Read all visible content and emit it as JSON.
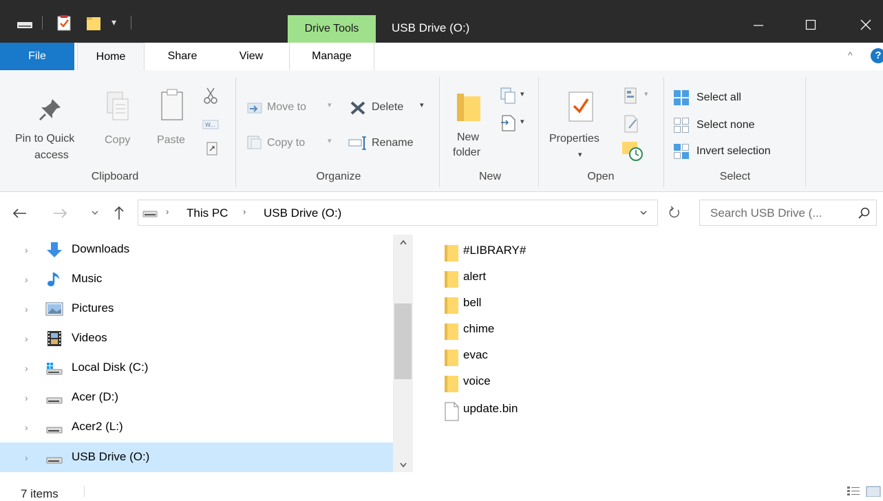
{
  "title": {
    "context_tab": "Drive Tools",
    "window_title": "USB Drive (O:)",
    "controls": {
      "minimize": "—",
      "maximize": "☐",
      "close": "✕"
    }
  },
  "tabs": {
    "file": "File",
    "home": "Home",
    "share": "Share",
    "view": "View",
    "manage": "Manage"
  },
  "ribbon": {
    "clipboard": {
      "group": "Clipboard",
      "pin_line1": "Pin to Quick",
      "pin_line2": "access",
      "copy": "Copy",
      "paste": "Paste"
    },
    "organize": {
      "group": "Organize",
      "move_to": "Move to",
      "copy_to": "Copy to",
      "delete": "Delete",
      "rename": "Rename"
    },
    "new": {
      "group": "New",
      "new_folder_line1": "New",
      "new_folder_line2": "folder"
    },
    "open": {
      "group": "Open",
      "properties": "Properties"
    },
    "select": {
      "group": "Select",
      "select_all": "Select all",
      "select_none": "Select none",
      "invert_selection": "Invert selection"
    }
  },
  "address": {
    "crumbs": [
      "This PC",
      "USB Drive (O:)"
    ],
    "search_placeholder": "Search USB Drive (..."
  },
  "nav": {
    "items": [
      {
        "label": "Downloads",
        "icon": "download-arrow-icon"
      },
      {
        "label": "Music",
        "icon": "music-note-icon"
      },
      {
        "label": "Pictures",
        "icon": "pictures-icon"
      },
      {
        "label": "Videos",
        "icon": "film-strip-icon"
      },
      {
        "label": "Local Disk (C:)",
        "icon": "system-drive-icon"
      },
      {
        "label": "Acer (D:)",
        "icon": "drive-icon"
      },
      {
        "label": "Acer2 (L:)",
        "icon": "drive-icon"
      },
      {
        "label": "USB Drive (O:)",
        "icon": "drive-icon",
        "selected": true
      }
    ]
  },
  "files": {
    "items": [
      {
        "name": "#LIBRARY#",
        "type": "folder"
      },
      {
        "name": "alert",
        "type": "folder"
      },
      {
        "name": "bell",
        "type": "folder"
      },
      {
        "name": "chime",
        "type": "folder"
      },
      {
        "name": "evac",
        "type": "folder"
      },
      {
        "name": "voice",
        "type": "folder"
      },
      {
        "name": "update.bin",
        "type": "file"
      }
    ]
  },
  "status": {
    "item_count": "7 items"
  },
  "colors": {
    "titlebar": "#2b2b2b",
    "drive_tools_tab": "#9fe08c",
    "file_tab": "#1979ca",
    "selection": "#cce8ff",
    "folder": "#ffd86b"
  }
}
